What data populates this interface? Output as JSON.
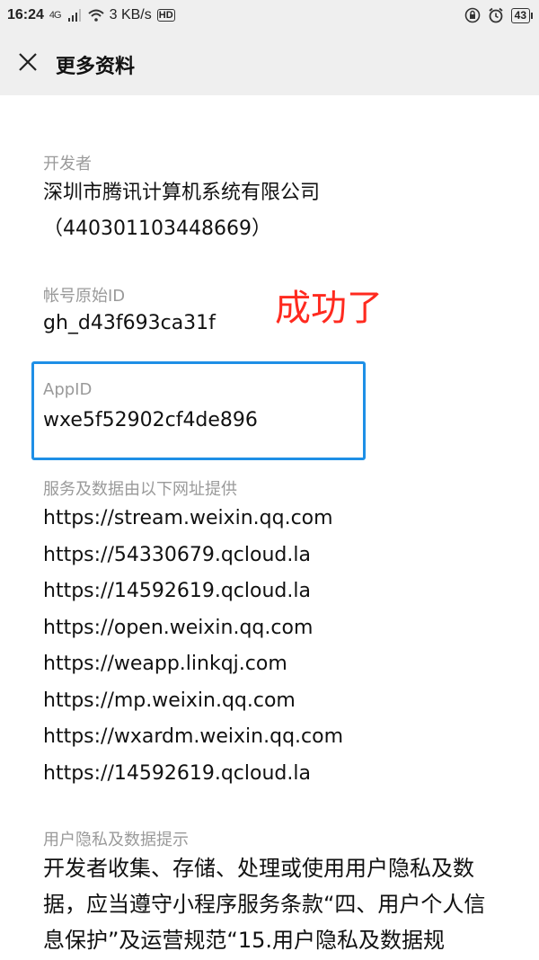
{
  "status_bar": {
    "time": "16:24",
    "network": "4G",
    "speed": "3 KB/s",
    "hd": "HD",
    "battery": "43"
  },
  "nav": {
    "title": "更多资料",
    "close_icon": "close-icon"
  },
  "developer": {
    "label": "开发者",
    "value": "深圳市腾讯计算机系统有限公司（440301103448669）"
  },
  "original_id": {
    "label": "帐号原始ID",
    "value": "gh_d43f693ca31f"
  },
  "annotation": "成功了",
  "appid": {
    "label": "AppID",
    "value": "wxe5f52902cf4de896",
    "highlight_color": "#1e8fe6"
  },
  "urls": {
    "label": "服务及数据由以下网址提供",
    "items": [
      "https://stream.weixin.qq.com",
      "https://54330679.qcloud.la",
      "https://14592619.qcloud.la",
      "https://open.weixin.qq.com",
      "https://weapp.linkqj.com",
      "https://mp.weixin.qq.com",
      "https://wxardm.weixin.qq.com",
      "https://14592619.qcloud.la"
    ]
  },
  "privacy": {
    "label": "用户隐私及数据提示",
    "value": "开发者收集、存储、处理或使用用户隐私及数据，应当遵守小程序服务条款“四、用户个人信息保护”及运营规范“15.用户隐私及数据规"
  }
}
